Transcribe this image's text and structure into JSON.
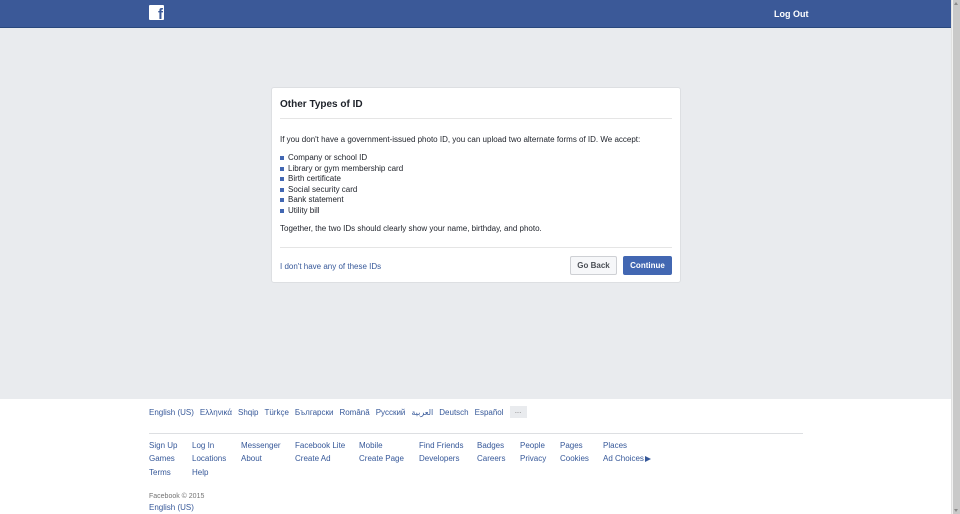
{
  "header": {
    "logo_letter": "f",
    "logout_label": "Log Out",
    "colors": {
      "bar": "#3b5998",
      "link": "#365899",
      "primary_button": "#4267b2"
    }
  },
  "dialog": {
    "title": "Other Types of ID",
    "intro": "If you don't have a government-issued photo ID, you can upload two alternate forms of ID. We accept:",
    "accepted_ids": [
      "Company or school ID",
      "Library or gym membership card",
      "Birth certificate",
      "Social security card",
      "Bank statement",
      "Utility bill"
    ],
    "together_text": "Together, the two IDs should clearly show your name, birthday, and photo.",
    "no_ids_link": "I don't have any of these IDs",
    "back_button": "Go Back",
    "continue_button": "Continue"
  },
  "footer": {
    "languages": [
      "English (US)",
      "Ελληνικά",
      "Shqip",
      "Türkçe",
      "Български",
      "Română",
      "Русский",
      "العربية",
      "Deutsch",
      "Español"
    ],
    "more_languages_label": "...",
    "links": [
      "Sign Up",
      "Games",
      "Terms",
      "Log In",
      "Locations",
      "Help",
      "Messenger",
      "About",
      "Facebook Lite",
      "Create Ad",
      "Mobile",
      "Create Page",
      "Find Friends",
      "Developers",
      "Badges",
      "Careers",
      "People",
      "Privacy",
      "Pages",
      "Cookies",
      "Places",
      "Ad Choices"
    ],
    "copyright": "Facebook © 2015",
    "current_language": "English (US)"
  }
}
